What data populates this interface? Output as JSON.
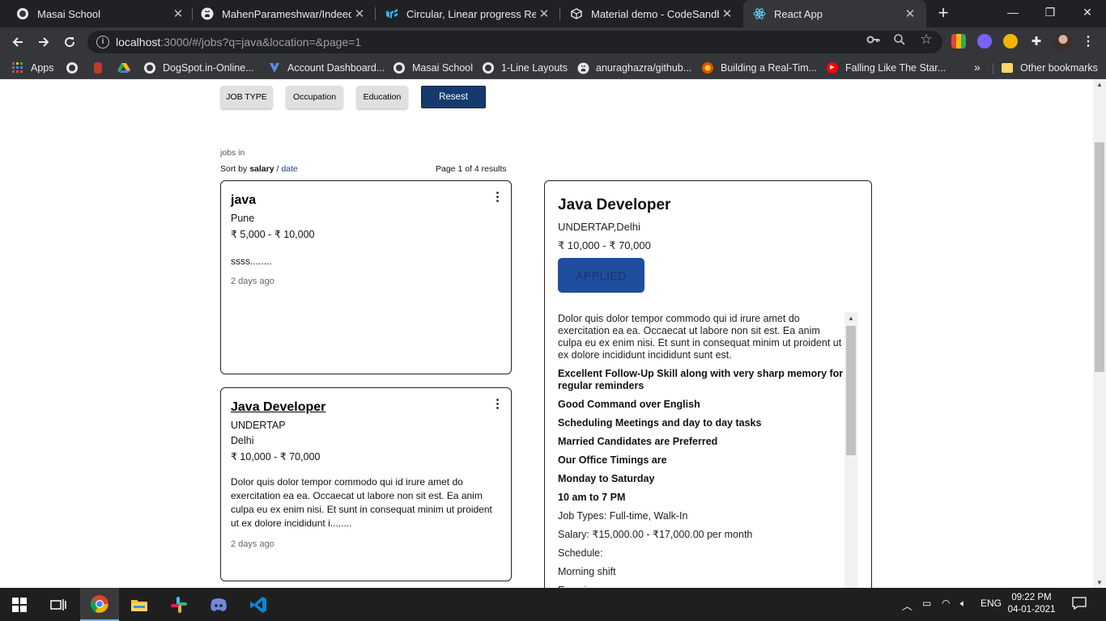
{
  "browser": {
    "tabs": [
      {
        "label": "Masai School",
        "favicon": "globe-icon",
        "active": false
      },
      {
        "label": "MahenParameshwar/IndeedRe",
        "favicon": "github-icon",
        "active": false
      },
      {
        "label": "Circular, Linear progress React",
        "favicon": "mui-icon",
        "active": false
      },
      {
        "label": "Material demo - CodeSandbox",
        "favicon": "codesandbox-icon",
        "active": false
      },
      {
        "label": "React App",
        "favicon": "react-icon",
        "active": true
      }
    ],
    "url_host": "localhost",
    "url_rest": ":3000/#/jobs?q=java&location=&page=1",
    "bookmarks": [
      {
        "label": "Apps",
        "icon": "apps-grid-icon"
      },
      {
        "label": "",
        "icon": "globe-icon"
      },
      {
        "label": "",
        "icon": "dog-icon"
      },
      {
        "label": "",
        "icon": "drive-icon"
      },
      {
        "label": "DogSpot.in-Online...",
        "icon": "globe-icon"
      },
      {
        "label": "Account Dashboard...",
        "icon": "vercel-icon"
      },
      {
        "label": "Masai School",
        "icon": "globe-icon"
      },
      {
        "label": "1-Line Layouts",
        "icon": "globe-icon"
      },
      {
        "label": "anuraghazra/github...",
        "icon": "github-icon"
      },
      {
        "label": "Building a Real-Tim...",
        "icon": "firebase-icon"
      },
      {
        "label": "Falling Like The Star...",
        "icon": "youtube-icon"
      }
    ],
    "other_bookmarks": "Other bookmarks"
  },
  "filters": {
    "job_type": "JOB TYPE",
    "occupation": "Occupation",
    "education": "Education",
    "reset": "Resest"
  },
  "results": {
    "jobs_in": "jobs in",
    "sort_prefix": "Sort by",
    "sort_salary": "salary",
    "sort_sep": " / ",
    "sort_date": "date",
    "page_info": "Page 1 of 4 results"
  },
  "cards": [
    {
      "title": "java",
      "location": "Pune",
      "salary": "₹ 5,000 - ₹ 10,000",
      "description": "ssss........",
      "posted": "2 days ago"
    },
    {
      "title": "Java Developer",
      "company": "UNDERTAP",
      "location": "Delhi",
      "salary": "₹ 10,000 - ₹ 70,000",
      "description": "Dolor quis dolor tempor commodo qui id irure amet do exercitation ea ea. Occaecat ut labore non sit est. Ea anim culpa eu ex enim nisi. Et sunt in consequat minim ut proident ut ex dolore incididunt i........",
      "posted": "2 days ago"
    }
  ],
  "detail": {
    "title": "Java Developer",
    "company_location": "UNDERTAP,Delhi",
    "salary": "₹ 10,000 - ₹ 70,000",
    "applied_label": "APPLIED",
    "paragraphs": [
      {
        "text": "Dolor quis dolor tempor commodo qui id irure amet do exercitation ea ea. Occaecat ut labore non sit est. Ea anim culpa eu ex enim nisi. Et sunt in consequat minim ut proident ut ex dolore incididunt incididunt sunt est.",
        "bold": false
      },
      {
        "text": "Excellent Follow-Up Skill along with very sharp memory for regular reminders",
        "bold": true
      },
      {
        "text": "Good Command over English",
        "bold": true
      },
      {
        "text": "Scheduling Meetings and day to day tasks",
        "bold": true
      },
      {
        "text": "Married Candidates are Preferred",
        "bold": true
      },
      {
        "text": "Our Office Timings are",
        "bold": true
      },
      {
        "text": "Monday to Saturday",
        "bold": true
      },
      {
        "text": "10 am to 7 PM",
        "bold": true
      },
      {
        "text": "Job Types: Full-time, Walk-In",
        "bold": false
      },
      {
        "text": "Salary: ₹15,000.00 - ₹17,000.00 per month",
        "bold": false
      },
      {
        "text": "Schedule:",
        "bold": false
      },
      {
        "text": "Morning shift",
        "bold": false
      },
      {
        "text": "Experience:",
        "bold": false
      }
    ]
  },
  "taskbar": {
    "language": "ENG",
    "time": "09:22 PM",
    "date": "04-01-2021"
  },
  "colors": {
    "accent_navy": "#173a6e",
    "applied_blue": "#1f4e9e",
    "chrome_dark": "#202124",
    "chrome_toolbar": "#35363a"
  }
}
